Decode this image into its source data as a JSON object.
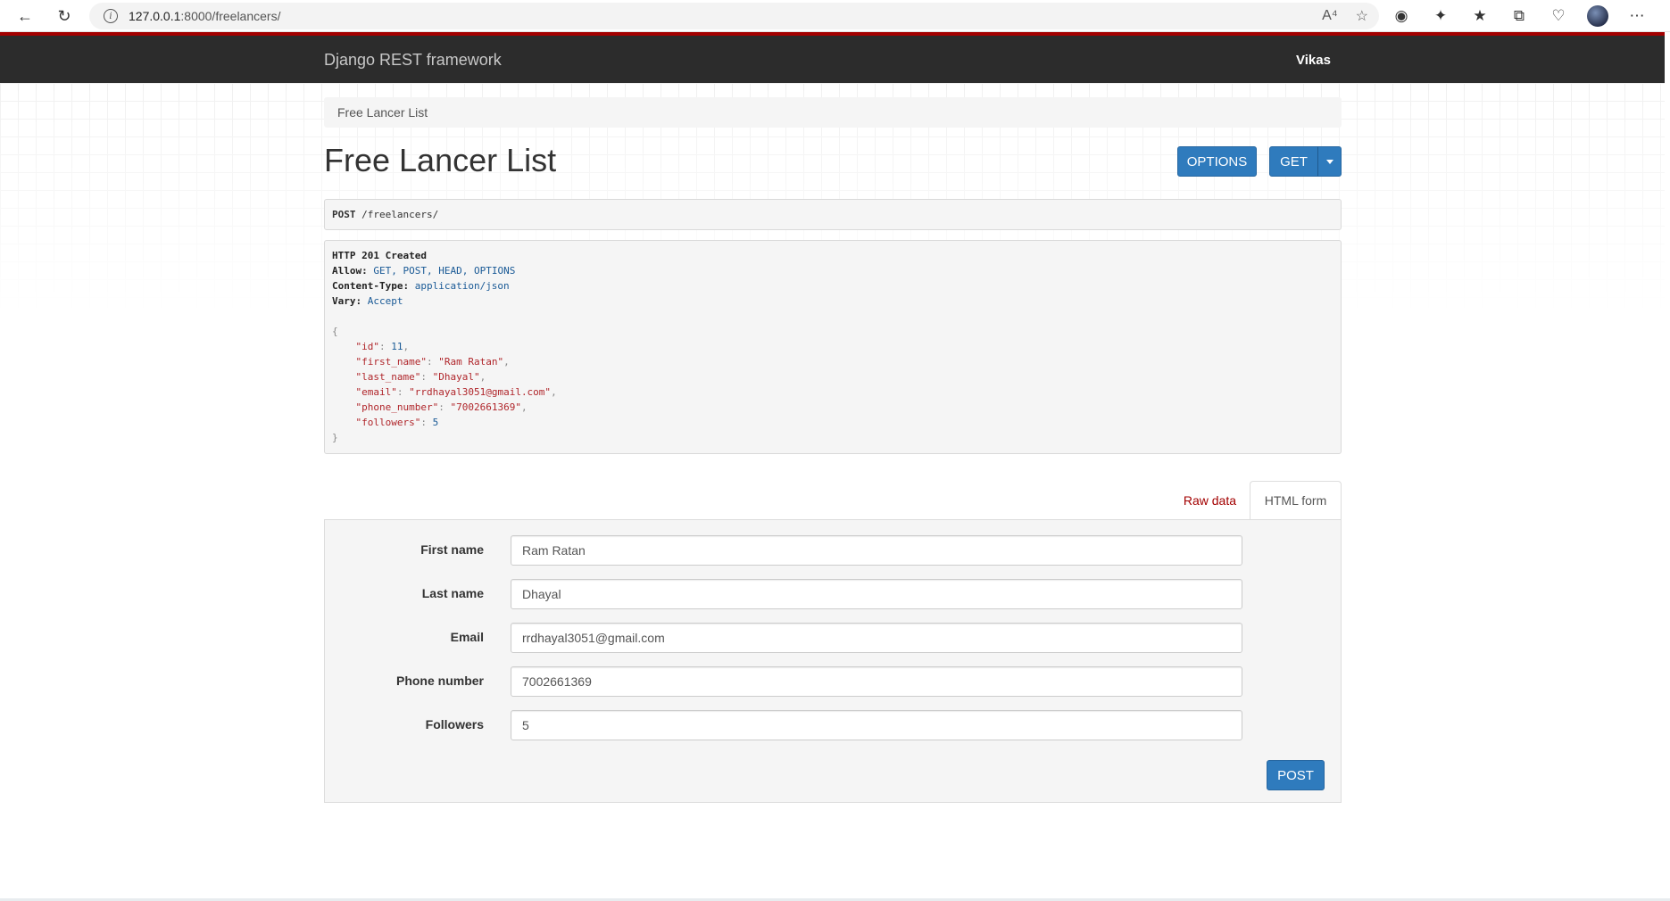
{
  "browser": {
    "url_host": "127.0.0.1",
    "url_rest": ":8000/freelancers/"
  },
  "navbar": {
    "brand": "Django REST framework",
    "user": "Vikas"
  },
  "breadcrumb": "Free Lancer List",
  "page_title": "Free Lancer List",
  "buttons": {
    "options": "OPTIONS",
    "get": "GET",
    "post": "POST"
  },
  "request": {
    "method": "POST",
    "path": " /freelancers/"
  },
  "response": {
    "status": "HTTP 201 Created",
    "headers": [
      {
        "name": "Allow:",
        "value": "GET, POST, HEAD, OPTIONS"
      },
      {
        "name": "Content-Type:",
        "value": "application/json"
      },
      {
        "name": "Vary:",
        "value": "Accept"
      }
    ],
    "body": [
      {
        "key": "\"id\"",
        "value": "11",
        "type": "num",
        "comma": true
      },
      {
        "key": "\"first_name\"",
        "value": "\"Ram Ratan\"",
        "type": "str",
        "comma": true
      },
      {
        "key": "\"last_name\"",
        "value": "\"Dhayal\"",
        "type": "str",
        "comma": true
      },
      {
        "key": "\"email\"",
        "value": "\"rrdhayal3051@gmail.com\"",
        "type": "str",
        "comma": true
      },
      {
        "key": "\"phone_number\"",
        "value": "\"7002661369\"",
        "type": "str",
        "comma": true
      },
      {
        "key": "\"followers\"",
        "value": "5",
        "type": "num",
        "comma": false
      }
    ]
  },
  "tabs": {
    "raw": "Raw data",
    "html": "HTML form"
  },
  "form": {
    "fields": [
      {
        "label": "First name",
        "value": "Ram Ratan"
      },
      {
        "label": "Last name",
        "value": "Dhayal"
      },
      {
        "label": "Email",
        "value": "rrdhayal3051@gmail.com"
      },
      {
        "label": "Phone number",
        "value": "7002661369"
      },
      {
        "label": "Followers",
        "value": "5"
      }
    ]
  }
}
